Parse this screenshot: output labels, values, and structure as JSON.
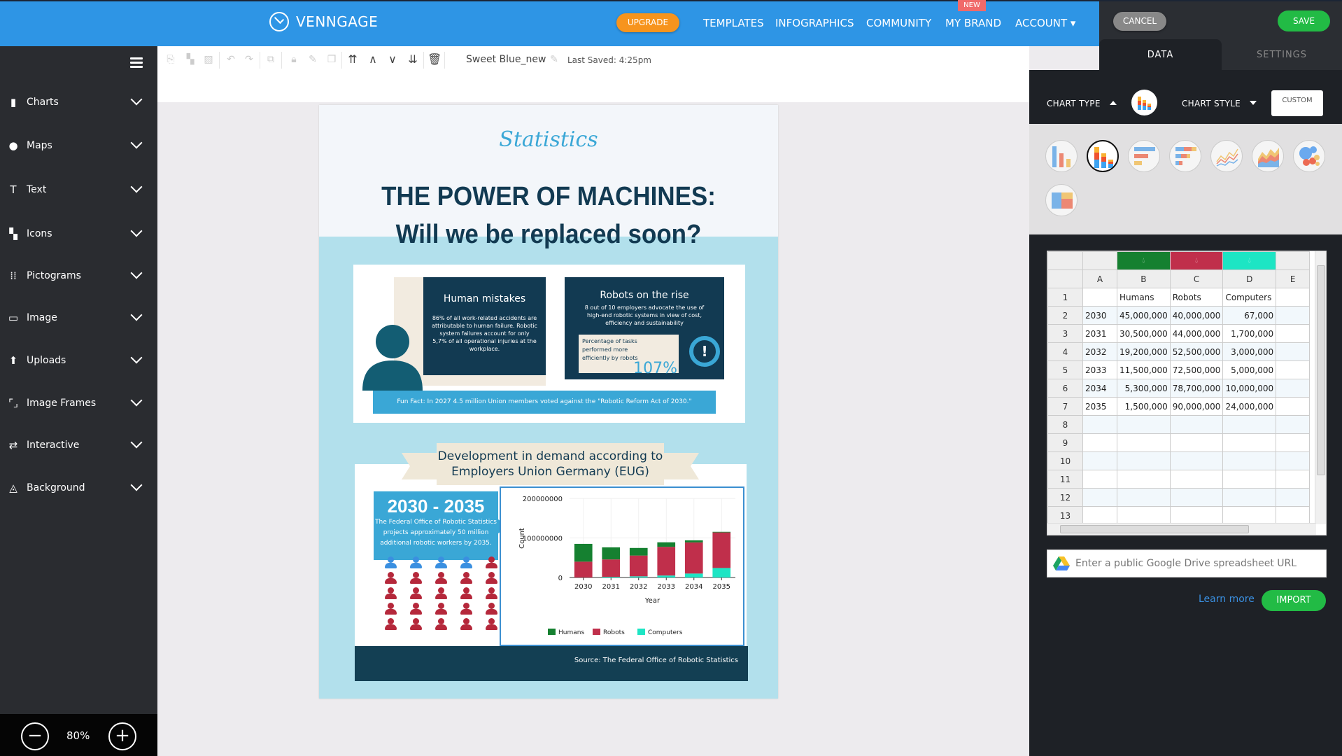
{
  "header": {
    "brand": "VENNGAGE",
    "upgrade": "UPGRADE",
    "nav": [
      "TEMPLATES",
      "INFOGRAPHICS",
      "COMMUNITY",
      "MY BRAND",
      "ACCOUNT ▾"
    ],
    "new_badge": "NEW",
    "cancel": "CANCEL",
    "save": "SAVE",
    "colors": {
      "topbar": "#2e95e5",
      "upgrade": "#f7941d",
      "save": "#22bb45"
    }
  },
  "sidebar": {
    "items": [
      {
        "label": "Charts",
        "icon": "bar-chart-icon"
      },
      {
        "label": "Maps",
        "icon": "globe-icon"
      },
      {
        "label": "Text",
        "icon": "text-icon"
      },
      {
        "label": "Icons",
        "icon": "shapes-icon"
      },
      {
        "label": "Pictograms",
        "icon": "grid-dots-icon"
      },
      {
        "label": "Image",
        "icon": "image-icon"
      },
      {
        "label": "Uploads",
        "icon": "upload-icon"
      },
      {
        "label": "Image Frames",
        "icon": "frame-icon"
      },
      {
        "label": "Interactive",
        "icon": "shuffle-icon"
      },
      {
        "label": "Background",
        "icon": "drop-icon"
      }
    ],
    "zoom": "80%"
  },
  "toolbar": {
    "doc_name": "Sweet Blue_new",
    "last_saved": "Last Saved: 4:25pm"
  },
  "infographic": {
    "kicker": "Statistics",
    "title_line1": "THE POWER OF MACHINES:",
    "title_line2": "Will we be replaced soon?",
    "human_title": "Human mistakes",
    "human_text": "86% of all work-related accidents are attributable to human failure. Robotic system failures account for only 5,7% of all operational injuries at the workplace.",
    "robots_title": "Robots on the rise",
    "robots_text": "8 out of 10 employers advocate the use of high-end robotic systems in view of cost, efficiency and sustainability",
    "pct_label": "Percentage of tasks performed more efficiently by robots",
    "pct_value": "107%",
    "fun_fact": "Fun Fact: In 2027 4.5 million Union members voted against the \"Robotic Reform Act of 2030.\"",
    "ribbon_line1": "Development in demand according to",
    "ribbon_line2": "Employers Union Germany (EUG)",
    "years_title": "2030 - 2035",
    "years_text": "The Federal Office of Robotic Statistics projects approximately 50 million additional robotic workers by 2035.",
    "pictogram": {
      "total": 25,
      "blue": 4
    },
    "source": "Source: The Federal Office of Robotic Statistics"
  },
  "chart_data": {
    "type": "bar",
    "stacked": true,
    "categories": [
      "2030",
      "2031",
      "2032",
      "2033",
      "2034",
      "2035"
    ],
    "series": [
      {
        "name": "Computers",
        "color": "#1de5c4",
        "values": [
          67000,
          1700000,
          3000000,
          5000000,
          10000000,
          24000000
        ]
      },
      {
        "name": "Robots",
        "color": "#c02f4b",
        "values": [
          40000000,
          44000000,
          52500000,
          72500000,
          78700000,
          90000000
        ]
      },
      {
        "name": "Humans",
        "color": "#158030",
        "values": [
          45000000,
          30500000,
          19200000,
          11500000,
          5300000,
          1500000
        ]
      }
    ],
    "legend_order": [
      "Humans",
      "Robots",
      "Computers"
    ],
    "yticks": [
      "0",
      "100000000",
      "200000000"
    ],
    "xlabel": "Year",
    "ylabel": "Count",
    "ylim": [
      0,
      200000000
    ],
    "grid": true,
    "legend": "bottom"
  },
  "panel": {
    "tabs": [
      "DATA",
      "SETTINGS"
    ],
    "chart_type_label": "CHART TYPE",
    "chart_style_label": "CHART STYLE",
    "custom_label": "CUSTOM",
    "chart_types": [
      "bar",
      "stacked-bar",
      "horizontal-bar",
      "stacked-horizontal-bar",
      "line",
      "area",
      "bubble",
      "treemap"
    ],
    "selected_chart_type": "stacked-bar",
    "sheet": {
      "columns": [
        "A",
        "B",
        "C",
        "D",
        "E"
      ],
      "column_colors": {
        "B": "#158030",
        "C": "#c02f4b",
        "D": "#1de5c4"
      },
      "rows": [
        [
          "",
          "Humans",
          "Robots",
          "Computers",
          ""
        ],
        [
          "2030",
          "45,000,000",
          "40,000,000",
          "67,000",
          ""
        ],
        [
          "2031",
          "30,500,000",
          "44,000,000",
          "1,700,000",
          ""
        ],
        [
          "2032",
          "19,200,000",
          "52,500,000",
          "3,000,000",
          ""
        ],
        [
          "2033",
          "11,500,000",
          "72,500,000",
          "5,000,000",
          ""
        ],
        [
          "2034",
          "5,300,000",
          "78,700,000",
          "10,000,000",
          ""
        ],
        [
          "2035",
          "1,500,000",
          "90,000,000",
          "24,000,000",
          ""
        ],
        [
          "",
          "",
          "",
          "",
          ""
        ],
        [
          "",
          "",
          "",
          "",
          ""
        ],
        [
          "",
          "",
          "",
          "",
          ""
        ],
        [
          "",
          "",
          "",
          "",
          ""
        ],
        [
          "",
          "",
          "",
          "",
          ""
        ],
        [
          "",
          "",
          "",
          "",
          ""
        ]
      ]
    },
    "gdrive_placeholder": "Enter a public Google Drive spreadsheet URL",
    "learn_more": "Learn more",
    "import": "IMPORT"
  }
}
